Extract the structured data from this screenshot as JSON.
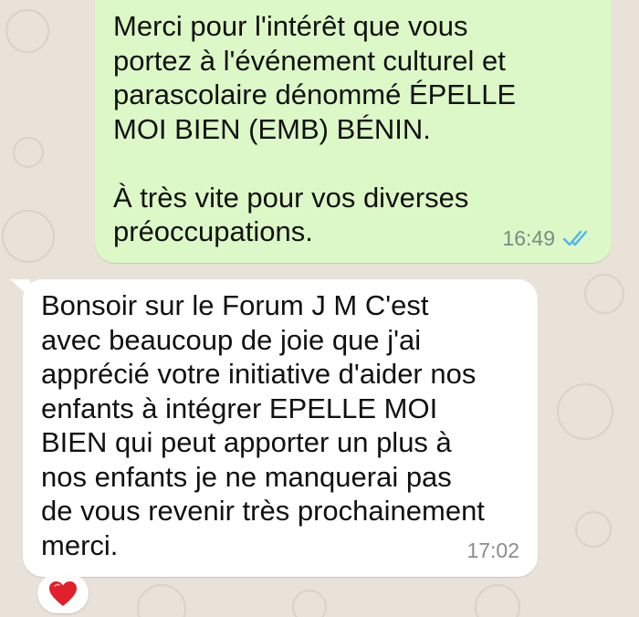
{
  "messages": [
    {
      "direction": "outgoing",
      "text": "Merci pour l'intérêt que vous\nportez à l'événement culturel et\nparascolaire dénommé ÉPELLE\nMOI BIEN (EMB) BÉNIN.\n\nÀ très vite pour vos diverses\npréoccupations.",
      "time": "16:49",
      "status_icon": "double-check-read-icon"
    },
    {
      "direction": "incoming",
      "text": "Bonsoir sur le Forum J M C'est\navec beaucoup de joie que j'ai\napprécié votre initiative d'aider nos\nenfants à intégrer EPELLE MOI\nBIEN qui peut apporter un plus à\nnos enfants je ne manquerai pas\nde vous revenir très prochainement\nmerci.",
      "time": "17:02",
      "reaction": "heart-icon"
    }
  ],
  "colors": {
    "outgoing_bubble": "#dcf8c6",
    "incoming_bubble": "#ffffff",
    "read_ticks": "#4fb6ec",
    "heart": "#e0202a",
    "background": "#e9e2d8"
  }
}
